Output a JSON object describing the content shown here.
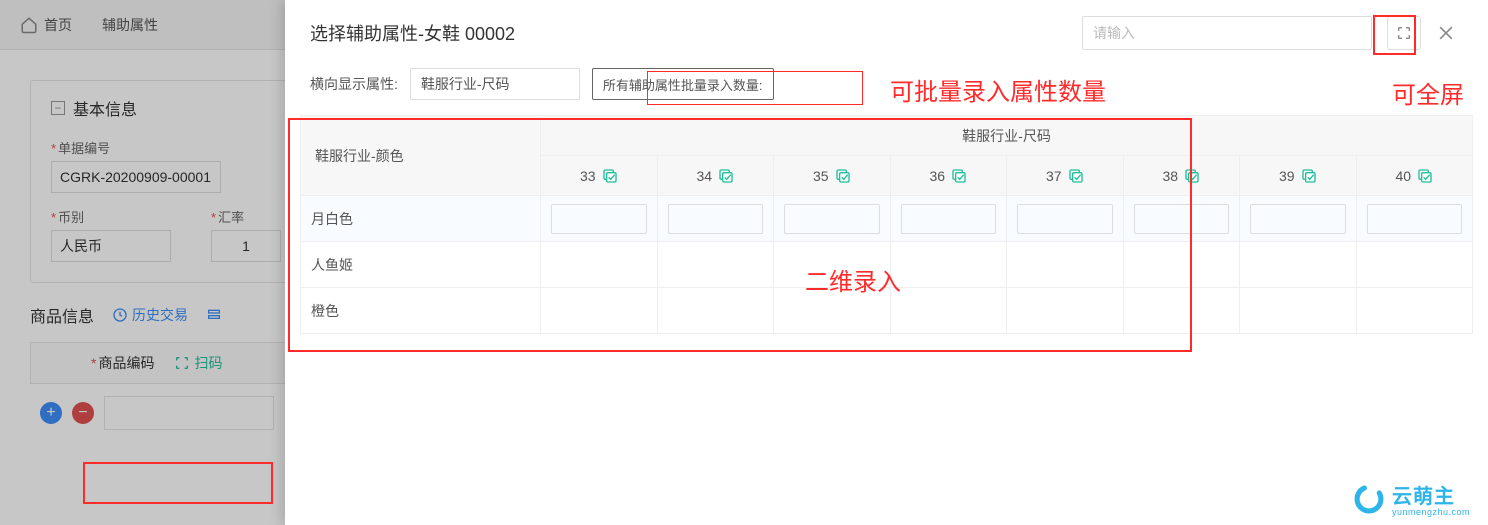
{
  "bg": {
    "home": "首页",
    "tab": "辅助属性",
    "panel_title": "基本信息",
    "field_doc_label": "单据编号",
    "field_doc_value": "CGRK-20200909-00001",
    "field_curr_label": "币别",
    "field_curr_value": "人民币",
    "field_rate_label": "汇率",
    "field_rate_value": "1",
    "goods_title": "商品信息",
    "history_link": "历史交易",
    "col_code": "商品编码",
    "scan_label": "扫码"
  },
  "modal": {
    "title": "选择辅助属性-女鞋  00002",
    "search_placeholder": "请输入",
    "horiz_label": "横向显示属性:",
    "horiz_value": "鞋服行业-尺码",
    "batch_label": "所有辅助属性批量录入数量:",
    "row_attr_label": "鞋服行业-颜色",
    "col_group_label": "鞋服行业-尺码",
    "sizes": [
      "33",
      "34",
      "35",
      "36",
      "37",
      "38",
      "39",
      "40"
    ],
    "colors": [
      "月白色",
      "人鱼姬",
      "橙色"
    ]
  },
  "annot": {
    "batch_note": "可批量录入属性数量",
    "fullscreen_note": "可全屏",
    "grid_note": "二维录入"
  },
  "logo": {
    "brand": "云萌主",
    "url": "yunmengzhu.com"
  },
  "colors": {
    "accent_green": "#1fbf9c",
    "link_blue": "#3d8ef7",
    "red": "#ff2a2a"
  }
}
